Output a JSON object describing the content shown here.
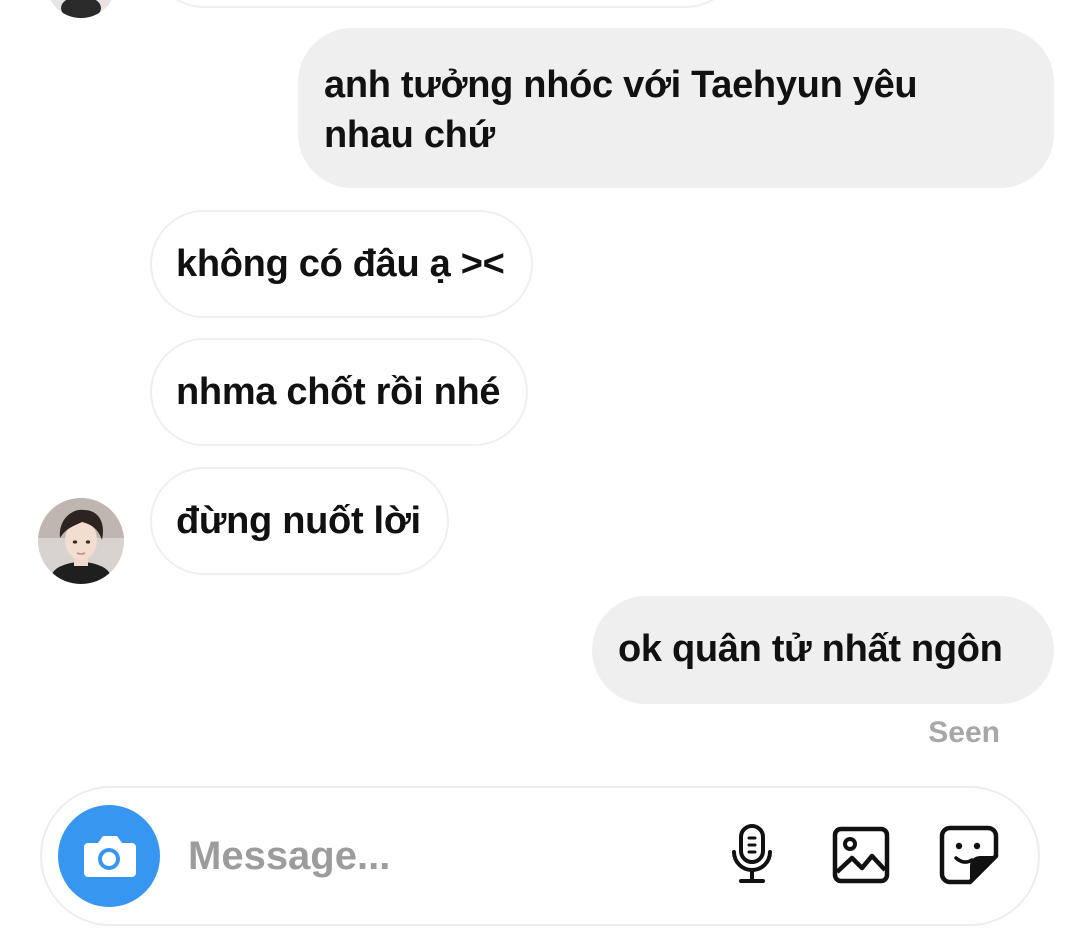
{
  "messages": [
    {
      "direction": "outgoing",
      "lines": [
        "anh tưởng nhóc với Taehyun yêu",
        "nhau chứ"
      ]
    },
    {
      "direction": "incoming",
      "text": "không có đâu ạ ><"
    },
    {
      "direction": "incoming",
      "text": "nhma chốt rồi nhé"
    },
    {
      "direction": "incoming",
      "text": "đừng nuốt lời"
    },
    {
      "direction": "outgoing",
      "text": "ok quân tử nhất ngôn"
    }
  ],
  "status": {
    "seen": "Seen"
  },
  "composer": {
    "placeholder": "Message..."
  },
  "icons": {
    "camera": "camera-icon",
    "microphone": "microphone-icon",
    "gallery": "gallery-icon",
    "sticker": "sticker-icon"
  },
  "colors": {
    "outgoing_bubble": "#efefef",
    "incoming_border": "#efefef",
    "camera_button": "#3797f0",
    "seen_text": "#a7a7a7",
    "placeholder": "#9c9c9c"
  }
}
